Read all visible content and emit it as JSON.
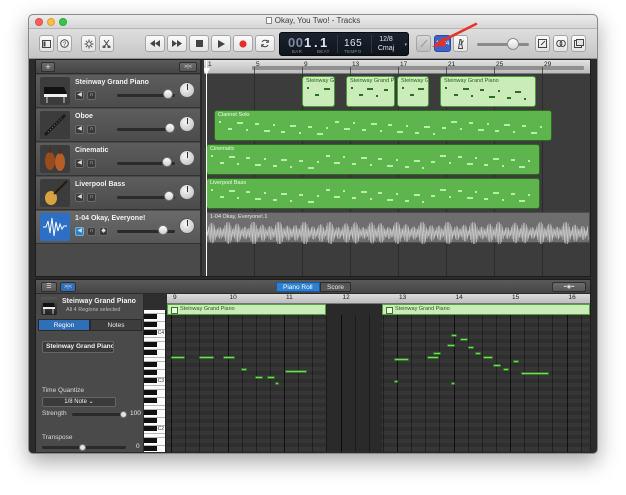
{
  "window": {
    "title": "Okay, You Two! - Tracks"
  },
  "toolbar": {
    "buttons": [
      "library",
      "help",
      "smart-controls",
      "editors",
      "rewind",
      "fast-forward",
      "stop",
      "play",
      "record",
      "cycle",
      "tuner",
      "count-in",
      "metronome",
      "note-pad",
      "loop-browser",
      "media-browser"
    ],
    "count_in_label": "1234",
    "lcd": {
      "bar": "1",
      "beat": "1",
      "bar_label": "BAR",
      "beat_label": "BEAT",
      "tempo": "165",
      "tempo_label": "TEMPO",
      "signature": "12/8",
      "key": "Cmaj"
    },
    "master_volume_fraction": 0.62
  },
  "tracks": {
    "add_label": "+",
    "filter_label": ">|<",
    "list": [
      {
        "name": "Steinway Grand Piano",
        "type": "software-instrument",
        "color": "#5fb54d"
      },
      {
        "name": "Oboe",
        "type": "software-instrument",
        "color": "#5fb54d"
      },
      {
        "name": "Cinematic",
        "type": "software-instrument",
        "color": "#5fb54d"
      },
      {
        "name": "Liverpool Bass",
        "type": "software-instrument",
        "color": "#5fb54d"
      },
      {
        "name": "1-04 Okay, Everyone!",
        "type": "audio",
        "color": "#6e6e6e"
      }
    ],
    "ruler_ticks": [
      "1",
      "5",
      "9",
      "13",
      "17",
      "21",
      "25",
      "29"
    ],
    "regions": {
      "piano": [
        "Steinway G",
        "Steinway Grand Piano",
        "Steinway G",
        "Steinway Grand Piano"
      ],
      "oboe": "Clarinet Solo",
      "cinematic": "Cinematic",
      "bass": "Liverpool Bass",
      "audio": "1-04 Okay, Everyone!.1"
    }
  },
  "editor": {
    "tabs": [
      "Piano Roll",
      "Score"
    ],
    "active_tab": "Piano Roll",
    "inspector": {
      "track_name": "Steinway Grand Piano",
      "selection": "All 4 Regions selected",
      "tabs": [
        "Region",
        "Notes"
      ],
      "active_tab": "Region",
      "region_name": "Steinway Grand Piano",
      "time_quantize_label": "Time Quantize",
      "quantize_value": "1/8 Note",
      "strength_label": "Strength",
      "strength_value": "100",
      "transpose_label": "Transpose",
      "transpose_value": "0"
    },
    "ruler_ticks": [
      "9",
      "10",
      "11",
      "12",
      "13",
      "14",
      "15",
      "16"
    ],
    "region_banners": [
      "Steinway Grand Piano",
      "Steinway Grand Piano"
    ],
    "key_labels": [
      "C4",
      "C3",
      "C2"
    ]
  }
}
